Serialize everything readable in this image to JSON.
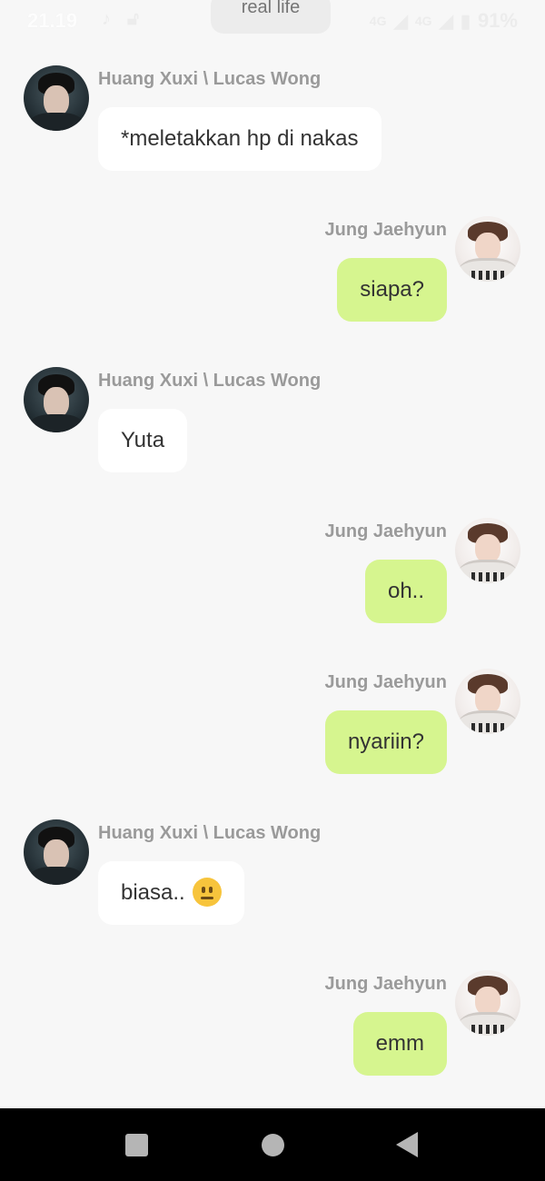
{
  "status_bar": {
    "time": "21.19",
    "icons_left": [
      "music-note-icon",
      "lock-icon"
    ],
    "network_1": "4G",
    "network_2": "4G",
    "battery_percent": "91%"
  },
  "story_title": "real life",
  "characters": {
    "left": "Huang Xuxi \\ Lucas Wong",
    "right": "Jung Jaehyun"
  },
  "messages": [
    {
      "side": "left",
      "name": "Huang Xuxi \\ Lucas Wong",
      "text": "*meletakkan hp di nakas"
    },
    {
      "side": "right",
      "name": "Jung Jaehyun",
      "text": "siapa?"
    },
    {
      "side": "left",
      "name": "Huang Xuxi \\ Lucas Wong",
      "text": "Yuta"
    },
    {
      "side": "right",
      "name": "Jung Jaehyun",
      "text": "oh.."
    },
    {
      "side": "right",
      "name": "Jung Jaehyun",
      "text": "nyariin?"
    },
    {
      "side": "left",
      "name": "Huang Xuxi \\ Lucas Wong",
      "text": "biasa..",
      "emoji": "neutral-face-emoji"
    },
    {
      "side": "right",
      "name": "Jung Jaehyun",
      "text": "emm"
    }
  ],
  "colors": {
    "background": "#f7f7f7",
    "left_bubble": "#ffffff",
    "right_bubble": "#d6f58f",
    "name_text": "#9a9a9a",
    "nav_bar": "#000000"
  },
  "nav": [
    "recents-button",
    "home-button",
    "back-button"
  ]
}
